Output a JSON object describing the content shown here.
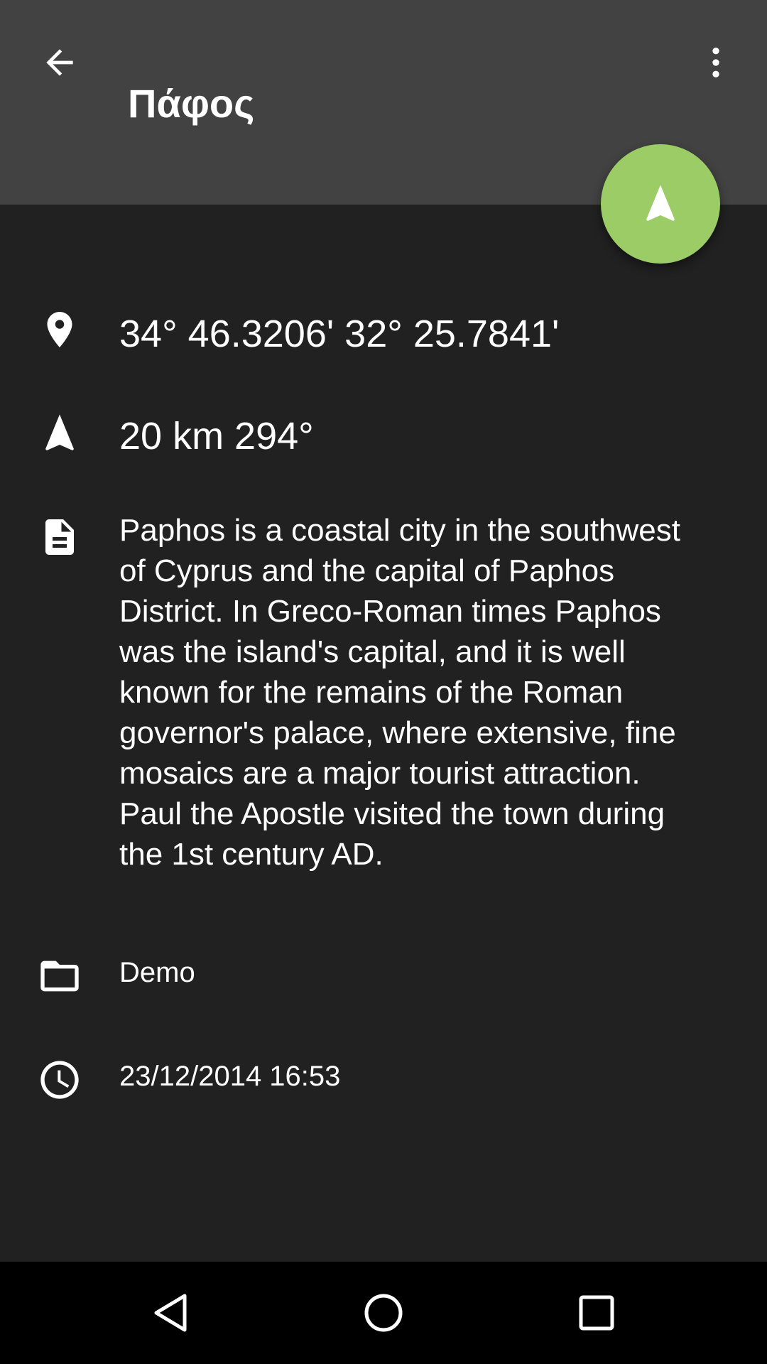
{
  "app_bar": {
    "title": "Πάφος",
    "back_icon": "arrow-back-icon",
    "overflow_icon": "more-vert-icon",
    "background": "#424242"
  },
  "fab": {
    "icon": "navigation-arrow-icon",
    "color": "#9ccc65"
  },
  "details": {
    "coordinates": "34° 46.3206' 32° 25.7841'",
    "distance_bearing": "20 km 294°",
    "description": "Paphos is a coastal city in the southwest of Cyprus and the capital of Paphos District. In Greco-Roman times Paphos was the island's capital, and it is well known for the remains of the Roman governor's palace, where extensive, fine mosaics are a major tourist attraction. Paul the Apostle visited the town during the 1st century AD.",
    "folder": "Demo",
    "timestamp": "23/12/2014 16:53"
  },
  "icons": {
    "coordinates": "location-pin-icon",
    "distance": "navigation-icon",
    "description": "document-icon",
    "folder": "folder-icon",
    "timestamp": "clock-icon"
  },
  "nav_bar": {
    "back_icon": "nav-back-icon",
    "home_icon": "nav-home-icon",
    "recents_icon": "nav-recents-icon"
  },
  "colors": {
    "background": "#212121",
    "accent": "#9ccc65",
    "text": "#ffffff"
  }
}
